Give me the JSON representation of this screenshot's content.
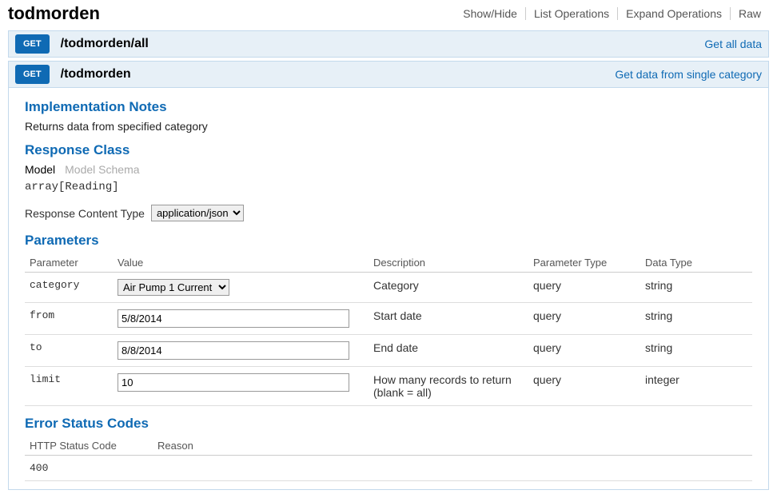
{
  "title": "todmorden",
  "header_links": [
    "Show/Hide",
    "List Operations",
    "Expand Operations",
    "Raw"
  ],
  "op1": {
    "method": "GET",
    "path": "/todmorden/all",
    "desc": "Get all data"
  },
  "op2": {
    "method": "GET",
    "path": "/todmorden",
    "desc": "Get data from single category"
  },
  "sections": {
    "impl_title": "Implementation Notes",
    "impl_text": "Returns data from specified category",
    "resp_title": "Response Class",
    "model_tab": "Model",
    "schema_tab": "Model Schema",
    "resp_body": "array[Reading]",
    "rct_label": "Response Content Type",
    "rct_value": "application/json",
    "params_title": "Parameters",
    "errors_title": "Error Status Codes"
  },
  "param_headers": [
    "Parameter",
    "Value",
    "Description",
    "Parameter Type",
    "Data Type"
  ],
  "params": [
    {
      "name": "category",
      "value": "Air Pump 1 Current",
      "desc": "Category",
      "ptype": "query",
      "dtype": "string",
      "input_type": "select"
    },
    {
      "name": "from",
      "value": "5/8/2014",
      "desc": "Start date",
      "ptype": "query",
      "dtype": "string",
      "input_type": "text"
    },
    {
      "name": "to",
      "value": "8/8/2014",
      "desc": "End date",
      "ptype": "query",
      "dtype": "string",
      "input_type": "text"
    },
    {
      "name": "limit",
      "value": "10",
      "desc": "How many records to return (blank = all)",
      "ptype": "query",
      "dtype": "integer",
      "input_type": "text"
    }
  ],
  "error_headers": [
    "HTTP Status Code",
    "Reason"
  ],
  "errors": [
    {
      "code": "400",
      "reason": ""
    }
  ]
}
